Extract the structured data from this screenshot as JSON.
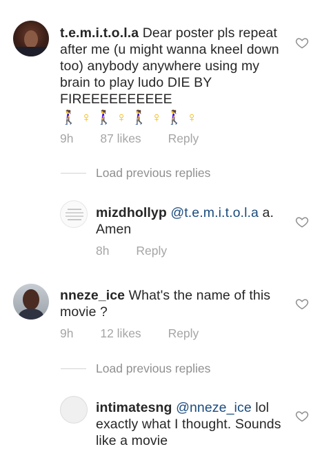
{
  "comments": [
    {
      "username": "t.e.m.i.t.o.l.a",
      "text": "Dear poster pls repeat after me (u might wanna kneel down too) anybody anywhere using my brain to play ludo DIE BY FIREEEEEEEEEE",
      "emoji": "🚶‍♀️ ♀ 🚶‍♀️ ♀ 🚶‍♀️ ♀ 🚶‍♀️ ♀",
      "time": "9h",
      "likes": "87 likes",
      "reply": "Reply"
    },
    {
      "load_previous": "Load previous replies"
    },
    {
      "username": "mizdhollyp",
      "mention": "@t.e.m.i.t.o.l.a",
      "text": "a. Amen",
      "time": "8h",
      "reply": "Reply"
    },
    {
      "username": "nneze_ice",
      "text": "What's the name of this movie ?",
      "time": "9h",
      "likes": "12 likes",
      "reply": "Reply"
    },
    {
      "load_previous": "Load previous replies"
    },
    {
      "username": "intimatesng",
      "mention": "@nneze_ice",
      "text": "lol exactly what I thought. Sounds like a movie"
    }
  ],
  "icons": {
    "like": "heart-outline-icon"
  }
}
